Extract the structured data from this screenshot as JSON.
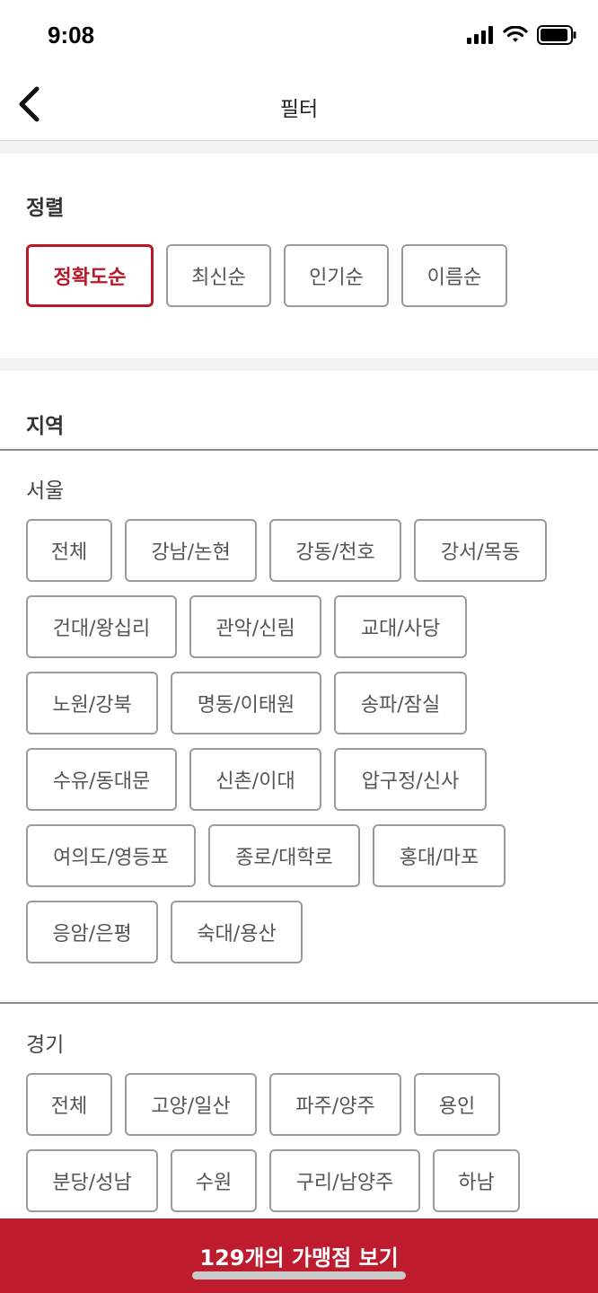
{
  "status_bar": {
    "time": "9:08"
  },
  "nav": {
    "title": "필터"
  },
  "sort": {
    "title": "정렬",
    "options": [
      {
        "label": "정확도순",
        "selected": true
      },
      {
        "label": "최신순",
        "selected": false
      },
      {
        "label": "인기순",
        "selected": false
      },
      {
        "label": "이름순",
        "selected": false
      }
    ]
  },
  "region": {
    "title": "지역",
    "groups": [
      {
        "name": "서울",
        "chips": [
          "전체",
          "강남/논현",
          "강동/천호",
          "강서/목동",
          "건대/왕십리",
          "관악/신림",
          "교대/사당",
          "노원/강북",
          "명동/이태원",
          "송파/잠실",
          "수유/동대문",
          "신촌/이대",
          "압구정/신사",
          "여의도/영등포",
          "종로/대학로",
          "홍대/마포",
          "응암/은평",
          "숙대/용산"
        ]
      },
      {
        "name": "경기",
        "chips": [
          "전체",
          "고양/일산",
          "파주/양주",
          "용인",
          "분당/성남",
          "수원",
          "구리/남양주",
          "하남"
        ]
      }
    ]
  },
  "cta": {
    "label": "129개의 가맹점 보기"
  },
  "colors": {
    "accent": "#be1b2e",
    "selected_text": "#b5192a",
    "border": "#9b9b9b"
  }
}
